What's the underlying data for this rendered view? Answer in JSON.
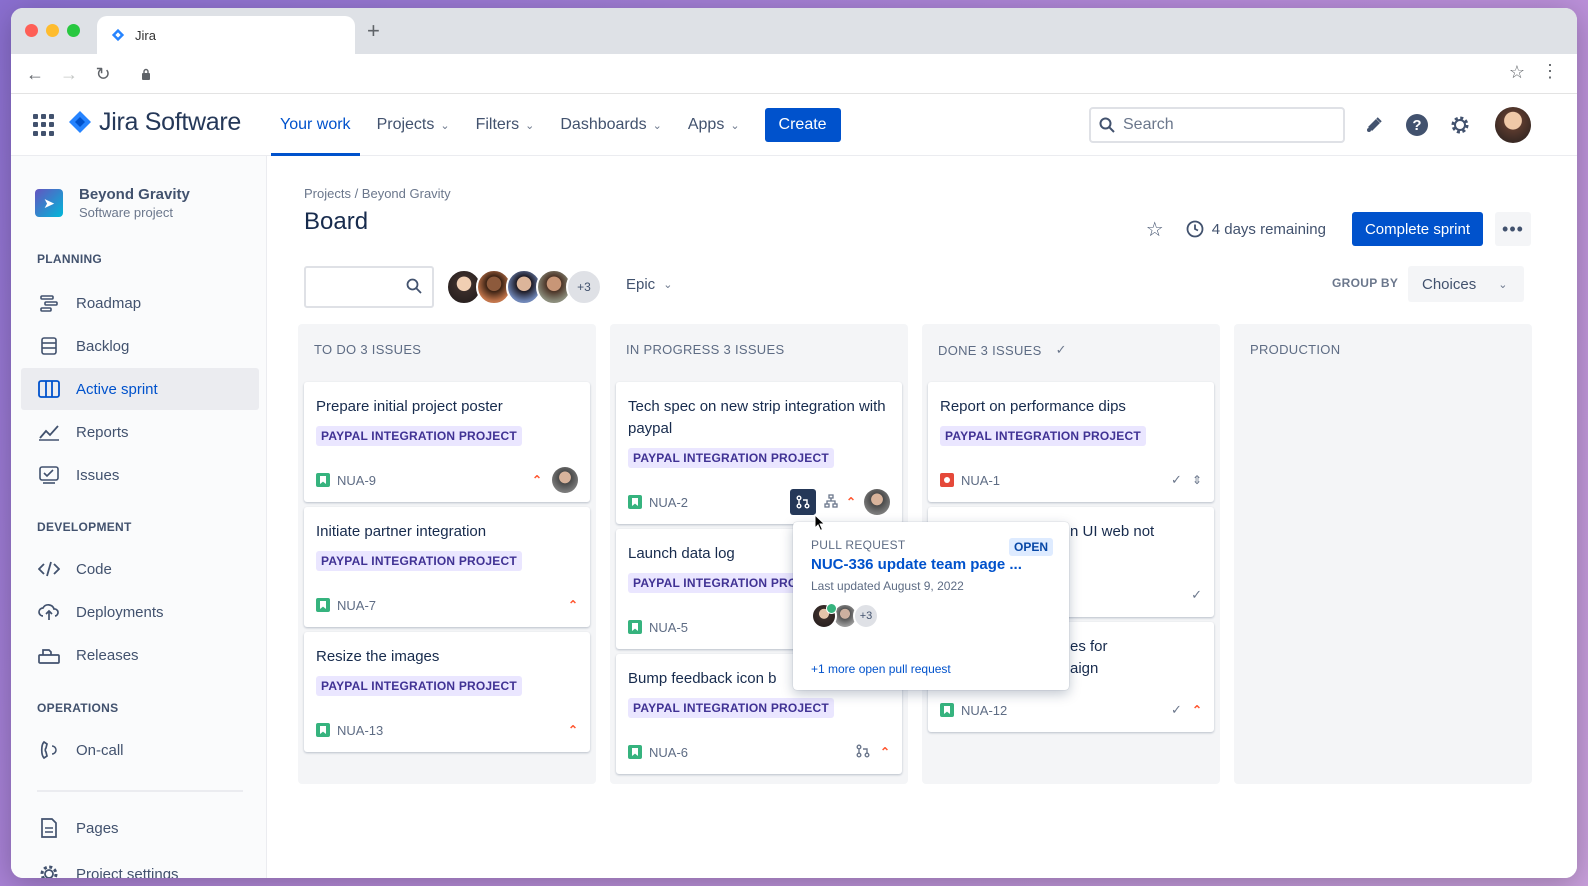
{
  "browser": {
    "tab_title": "Jira",
    "new_tab": "+"
  },
  "topnav": {
    "logo": "Jira Software",
    "items": [
      {
        "label": "Your work",
        "active": true,
        "dropdown": false
      },
      {
        "label": "Projects",
        "dropdown": true
      },
      {
        "label": "Filters",
        "dropdown": true
      },
      {
        "label": "Dashboards",
        "dropdown": true
      },
      {
        "label": "Apps",
        "dropdown": true
      }
    ],
    "create_label": "Create",
    "search_placeholder": "Search"
  },
  "sidebar": {
    "project_name": "Beyond Gravity",
    "project_type": "Software project",
    "planning_label": "PLANNING",
    "planning_items": [
      {
        "label": "Roadmap",
        "icon": "roadmap-icon"
      },
      {
        "label": "Backlog",
        "icon": "backlog-icon"
      },
      {
        "label": "Active sprint",
        "icon": "board-icon",
        "active": true
      },
      {
        "label": "Reports",
        "icon": "reports-icon"
      },
      {
        "label": "Issues",
        "icon": "issues-icon"
      }
    ],
    "development_label": "DEVELOPMENT",
    "development_items": [
      {
        "label": "Code",
        "icon": "code-icon"
      },
      {
        "label": "Deployments",
        "icon": "deployments-icon"
      },
      {
        "label": "Releases",
        "icon": "releases-icon"
      }
    ],
    "operations_label": "OPERATIONS",
    "operations_items": [
      {
        "label": "On-call",
        "icon": "on-call-icon"
      }
    ],
    "bottom_items": [
      {
        "label": "Pages",
        "icon": "pages-icon"
      },
      {
        "label": "Project settings",
        "icon": "settings-icon"
      }
    ]
  },
  "board": {
    "breadcrumb": "Projects / Beyond Gravity",
    "title": "Board",
    "remaining": "4 days remaining",
    "complete_label": "Complete sprint",
    "more_label": "•••",
    "avatar_more": "+3",
    "epic_label": "Epic",
    "group_by_label": "GROUP BY",
    "group_by_value": "Choices"
  },
  "columns": [
    {
      "title": "TO DO 3 ISSUES",
      "cards": [
        {
          "title": "Prepare initial project poster",
          "epic": "PAYPAL INTEGRATION PROJECT",
          "key": "NUA-9"
        },
        {
          "title": "Initiate partner integration",
          "epic": "PAYPAL INTEGRATION PROJECT",
          "key": "NUA-7"
        },
        {
          "title": "Resize the images",
          "epic": "PAYPAL INTEGRATION PROJECT",
          "key": "NUA-13"
        }
      ]
    },
    {
      "title": "IN PROGRESS 3 ISSUES",
      "cards": [
        {
          "title": "Tech spec on new strip integration with paypal",
          "epic": "PAYPAL INTEGRATION PROJECT",
          "key": "NUA-2"
        },
        {
          "title": "Launch data log",
          "epic": "PAYPAL INTEGRATION PROJECT",
          "key": "NUA-5"
        },
        {
          "title": "Bump feedback icon b",
          "epic": "PAYPAL INTEGRATION PROJECT",
          "key": "NUA-6"
        }
      ]
    },
    {
      "title": "DONE 3 ISSUES",
      "cards": [
        {
          "title": "Report on performance dips",
          "epic": "PAYPAL INTEGRATION PROJECT",
          "key": "NUA-1"
        },
        {
          "title": "n UI web not",
          "epic": "",
          "key": ""
        },
        {
          "title": "es for\naign",
          "epic": "",
          "key": "NUA-12"
        }
      ]
    },
    {
      "title": "PRODUCTION",
      "cards": []
    }
  ],
  "popup": {
    "label": "PULL REQUEST",
    "status": "OPEN",
    "title": "NUC-336 update team page ...",
    "updated": "Last updated August 9, 2022",
    "avatar_more": "+3",
    "more_link": "+1 more open pull request"
  },
  "colors": {
    "brand": "#0052cc",
    "epic_bg": "#eae6ff",
    "epic_text": "#403294",
    "story": "#36b37e",
    "bug": "#e5493a",
    "priority": "#ff5630"
  }
}
